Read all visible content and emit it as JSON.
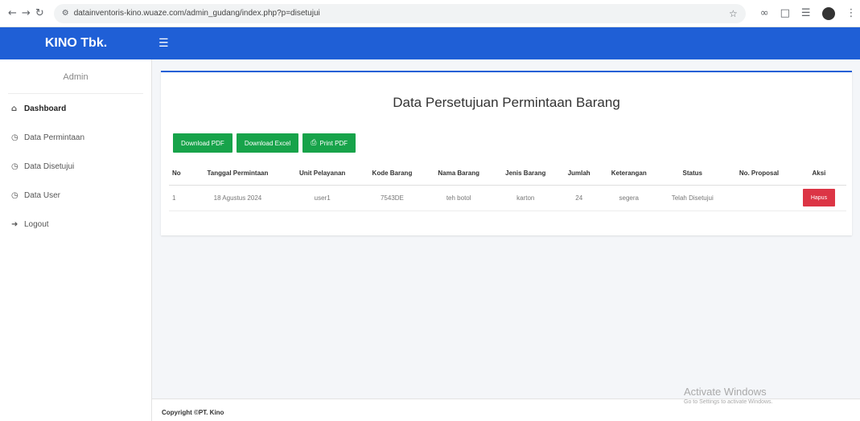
{
  "browser": {
    "url": "datainventoris-kino.wuaze.com/admin_gudang/index.php?p=disetujui",
    "back_icon": "arrow-left",
    "forward_icon": "arrow-right",
    "reload_icon": "reload"
  },
  "navbar": {
    "brand": "KINO Tbk.",
    "menu_icon": "hamburger"
  },
  "sidebar": {
    "user_label": "Admin",
    "items": [
      {
        "label": "Dashboard",
        "icon": "home"
      },
      {
        "label": "Data Permintaan",
        "icon": "clock"
      },
      {
        "label": "Data Disetujui",
        "icon": "clock"
      },
      {
        "label": "Data User",
        "icon": "clock"
      },
      {
        "label": "Logout",
        "icon": "sign-out"
      }
    ]
  },
  "main": {
    "title": "Data Persetujuan Permintaan Barang",
    "buttons": {
      "download_pdf": "Download PDF",
      "download_excel": "Download Excel",
      "print_pdf": "Print PDF"
    },
    "table": {
      "headers": [
        "No",
        "Tanggal Permintaan",
        "Unit Pelayanan",
        "Kode Barang",
        "Nama Barang",
        "Jenis Barang",
        "Jumlah",
        "Keterangan",
        "Status",
        "No. Proposal",
        "Aksi"
      ],
      "rows": [
        {
          "no": "1",
          "tanggal": "18 Agustus 2024",
          "unit": "user1",
          "kode": "7543DE",
          "nama": "teh botol",
          "jenis": "karton",
          "jumlah": "24",
          "keterangan": "segera",
          "status": "Telah Disetujui",
          "proposal": "",
          "aksi": "Hapus"
        }
      ]
    }
  },
  "footer": {
    "text": "Copyright ©PT. Kino"
  },
  "watermark": {
    "title": "Activate Windows",
    "subtitle": "Go to Settings to activate Windows."
  }
}
